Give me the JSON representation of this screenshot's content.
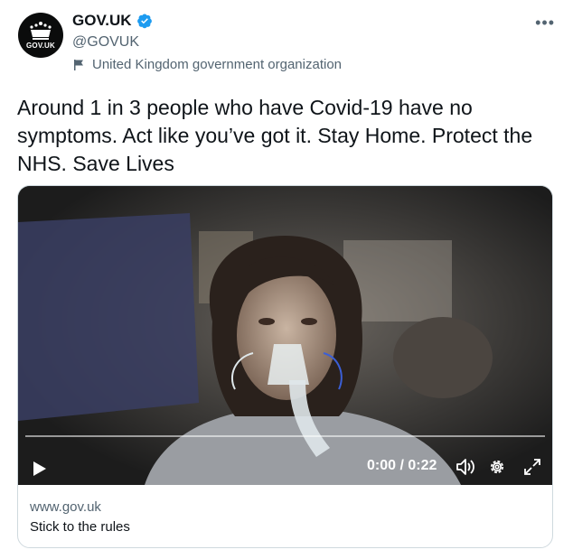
{
  "account": {
    "display_name": "GOV.UK",
    "handle": "@GOVUK",
    "avatar_text": "GOV.UK",
    "label": "United Kingdom government organization",
    "verified_color": "#1d9bf0"
  },
  "tweet": {
    "text": "Around 1 in 3 people who have Covid-19 have no symptoms. Act like you’ve got it.  Stay Home. Protect the NHS. Save Lives"
  },
  "video": {
    "time_display": "0:00 / 0:22",
    "progress": 0
  },
  "link_card": {
    "domain": "www.gov.uk",
    "title": "Stick to the rules"
  },
  "icons": {
    "more": "more-options-icon",
    "play": "play-icon",
    "volume": "volume-icon",
    "settings": "gear-icon",
    "fullscreen": "fullscreen-icon",
    "label": "flag-icon"
  }
}
